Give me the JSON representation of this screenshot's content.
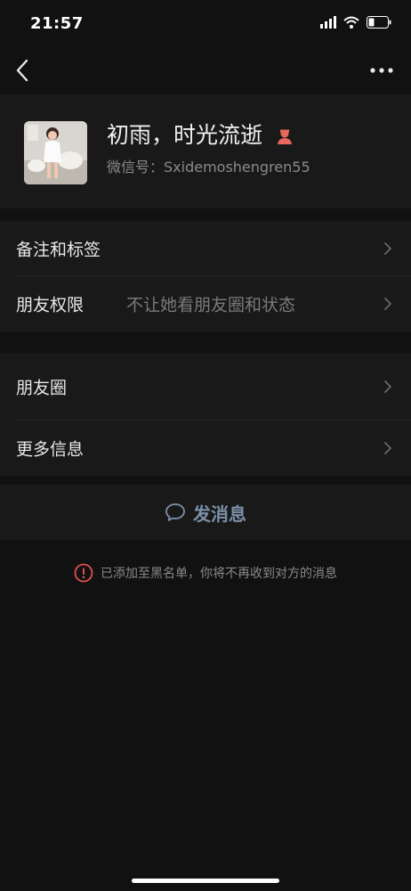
{
  "status_bar": {
    "time": "21:57"
  },
  "profile": {
    "nickname": "初雨，时光流逝",
    "wechat_id": "微信号：Sxidemoshengren55",
    "gender_icon": "female-user-icon",
    "gender_color": "#e8685e"
  },
  "rows": {
    "remark_tags": "备注和标签",
    "friend_permission": "朋友权限",
    "friend_permission_value": "不让她看朋友圈和状态",
    "moments": "朋友圈",
    "more_info": "更多信息"
  },
  "send_message": {
    "label": "发消息",
    "icon": "chat-bubble-icon"
  },
  "notice": {
    "text": "已添加至黑名单，你将不再收到对方的消息",
    "icon": "warning-circle-icon",
    "icon_color": "#e05050"
  },
  "colors": {
    "background": "#111111",
    "panel": "#191919",
    "accent": "#7d90a9"
  }
}
